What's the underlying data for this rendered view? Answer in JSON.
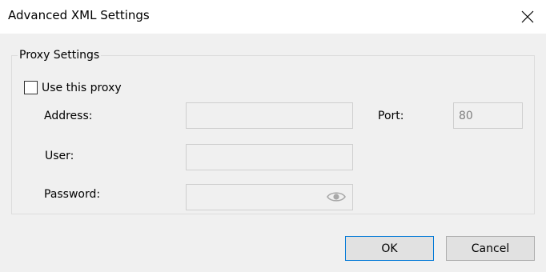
{
  "dialog": {
    "title": "Advanced XML Settings",
    "close_icon": "close-icon"
  },
  "proxy": {
    "group_label": "Proxy Settings",
    "use_proxy_label": "Use this proxy",
    "use_proxy_checked": false,
    "address_label": "Address:",
    "address_value": "",
    "port_label": "Port:",
    "port_value": "80",
    "user_label": "User:",
    "user_value": "",
    "password_label": "Password:",
    "password_value": "",
    "show_password_icon": "eye-icon"
  },
  "buttons": {
    "ok_label": "OK",
    "cancel_label": "Cancel"
  },
  "colors": {
    "accent": "#0078d7",
    "disabled_text": "#808080"
  }
}
